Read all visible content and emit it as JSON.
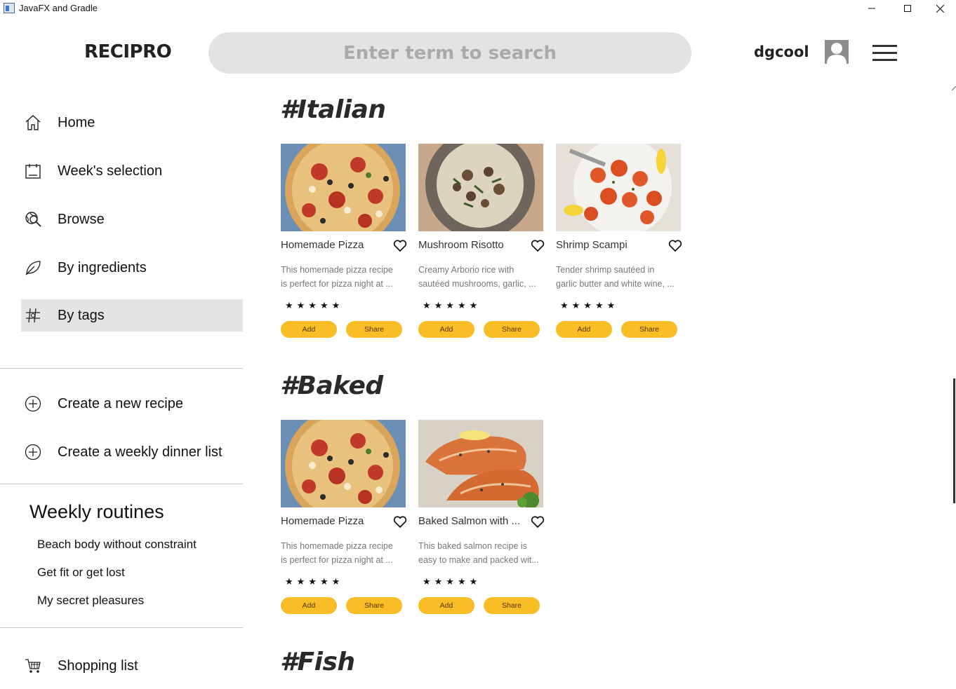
{
  "window": {
    "title": "JavaFX and Gradle"
  },
  "header": {
    "logo": "RECIPRO",
    "search_placeholder": "Enter term to search",
    "username": "dgcool"
  },
  "sidebar": {
    "nav": [
      {
        "label": "Home",
        "icon": "home-icon",
        "active": false
      },
      {
        "label": "Week's selection",
        "icon": "calendar-icon",
        "active": false
      },
      {
        "label": "Browse",
        "icon": "browse-icon",
        "active": false
      },
      {
        "label": "By ingredients",
        "icon": "leaf-icon",
        "active": false
      },
      {
        "label": "By tags",
        "icon": "hashtag-icon",
        "active": true
      }
    ],
    "actions": [
      {
        "label": "Create a new recipe",
        "icon": "plus-circle-icon"
      },
      {
        "label": "Create a weekly dinner list",
        "icon": "plus-circle-icon"
      }
    ],
    "routines_title": "Weekly routines",
    "routines": [
      "Beach body without constraint",
      "Get fit or get lost",
      "My secret pleasures"
    ],
    "shopping_list": {
      "label": "Shopping list",
      "icon": "cart-icon"
    }
  },
  "tags": [
    {
      "heading": "#Italian",
      "recipes": [
        {
          "title": "Homemade Pizza",
          "desc1": "This homemade pizza recipe",
          "desc2": "is perfect for pizza night at ...",
          "stars": "★★★★★",
          "add": "Add",
          "share": "Share",
          "image": "pizza"
        },
        {
          "title": "Mushroom Risotto",
          "desc1": "Creamy Arborio rice with",
          "desc2": "sautéed mushrooms, garlic, ...",
          "stars": "★★★★★",
          "add": "Add",
          "share": "Share",
          "image": "risotto"
        },
        {
          "title": "Shrimp Scampi",
          "desc1": "Tender shrimp sautéed in",
          "desc2": "garlic butter and white wine, ...",
          "stars": "★★★★★",
          "add": "Add",
          "share": "Share",
          "image": "shrimp"
        }
      ]
    },
    {
      "heading": "#Baked",
      "recipes": [
        {
          "title": "Homemade Pizza",
          "desc1": "This homemade pizza recipe",
          "desc2": "is perfect for pizza night at ...",
          "stars": "★★★★★",
          "add": "Add",
          "share": "Share",
          "image": "pizza"
        },
        {
          "title": "Baked Salmon with ...",
          "desc1": "This baked salmon recipe is",
          "desc2": "easy to make and packed wit...",
          "stars": "★★★★★",
          "add": "Add",
          "share": "Share",
          "image": "salmon"
        }
      ]
    },
    {
      "heading": "#Fish",
      "recipes": []
    }
  ],
  "colors": {
    "accent": "#f9bd26",
    "active_nav": "#e4e4e4",
    "search_bg": "#e3e3e3"
  }
}
